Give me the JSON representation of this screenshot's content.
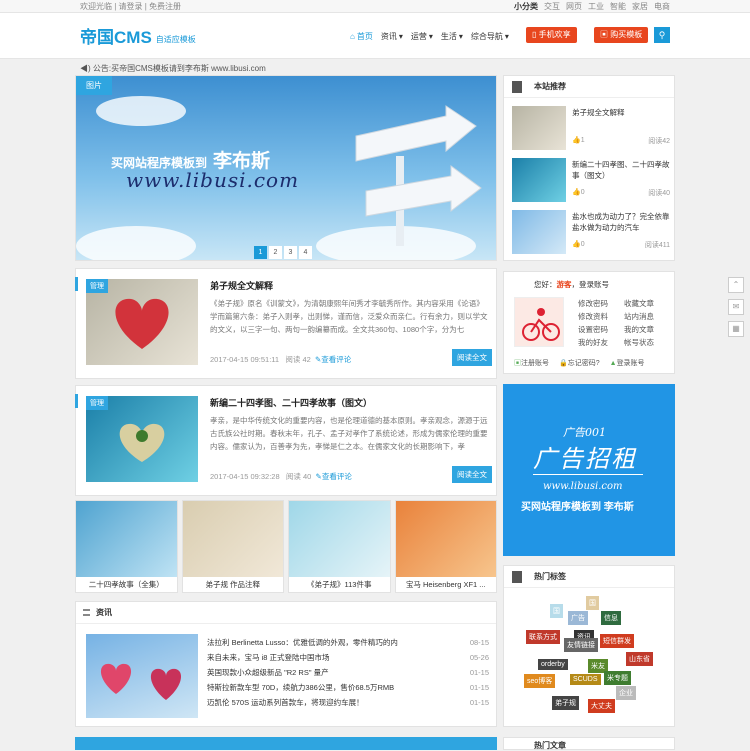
{
  "topbar": {
    "welcome": "欢迎光临",
    "login": "请登录",
    "register": "免费注册",
    "links": [
      "小分类",
      "交互",
      "网页",
      "工业",
      "智能",
      "家居",
      "电商"
    ]
  },
  "header": {
    "logo": "帝国CMS",
    "logo_sub": "自适应模板",
    "nav": [
      "首页",
      "资讯",
      "运营",
      "生活",
      "综合导航"
    ],
    "btn_mobile": "手机欢享",
    "btn_buy": "购买模板"
  },
  "notice": "公告:买帝国CMS模板请到李布斯 www.libusi.com",
  "slider": {
    "tag": "图片",
    "title": "买网站程序模板到",
    "title_big": "李布斯",
    "url": "www.libusi.com",
    "pages": [
      "1",
      "2",
      "3",
      "4"
    ]
  },
  "posts": [
    {
      "cat": "管理",
      "title": "弟子规全文解释",
      "desc": "《弟子规》原名《训蒙文》，为清朝康熙年间秀才李毓秀所作。其内容采用《论语》学而篇第六条：弟子入则孝，出则悌，谨而信，泛爱众而亲仁。行有余力，则以学文的文义，以三字一句、两句一韵编纂而成。全文共360句、1080个字，分为七",
      "date": "2017-04-15 09:51:11",
      "views": "阅读 42",
      "comment": "查看评论",
      "more": "阅读全文"
    },
    {
      "cat": "管理",
      "title": "新编二十四孝图、二十四孝故事（图文）",
      "desc": "孝亲，是中华传统文化的重要内容，也是伦理道德的基本原则。孝亲观念，源源于远古氏族公社时期。春秋末年，孔子、孟子对孝作了系统论述，形成为儒家伦理的重要内容。儒家认为，百善孝为先，孝悌是仁之本。在儒家文化的长期影响下，孝",
      "date": "2017-04-15 09:32:28",
      "views": "阅读 40",
      "comment": "查看评论",
      "more": "阅读全文"
    }
  ],
  "tiles": [
    "二十四孝故事（全集）",
    "弟子规 作品注释",
    "《弟子规》113件事",
    "宝马 Heisenberg XF1 ..."
  ],
  "latest": {
    "title": "资讯",
    "items": [
      {
        "t": "法拉利 Berlinetta Lusso：优雅低调的外观，零件精巧的内",
        "d": "08-15"
      },
      {
        "t": "来自未来，宝马 i8 正式登陆中国市场",
        "d": "05-26"
      },
      {
        "t": "英国现款小众超级新品 \"R2 RS\" 量产",
        "d": "01-15"
      },
      {
        "t": "特斯拉新款车型 70D，续航力386公里，售价68.5万RMB",
        "d": "01-15"
      },
      {
        "t": "迈凯伦 570S 运动系列首款车，将现迎约车展！",
        "d": "01-15"
      }
    ]
  },
  "recommend": {
    "title": "本站推荐",
    "items": [
      {
        "t": "弟子规全文解释",
        "likes": "1",
        "views": "阅读42"
      },
      {
        "t": "新编二十四孝图、二十四孝故事（图文）",
        "likes": "0",
        "views": "阅读40"
      },
      {
        "t": "盐水也成为动力了？完全依靠盐水做为动力的汽车",
        "likes": "0",
        "views": "阅读411"
      }
    ]
  },
  "login": {
    "hello": "您好：",
    "guest": "游客",
    "action": "，登录账号",
    "links": [
      "修改密码",
      "收藏文章",
      "修改资料",
      "站内消息",
      "设置密码",
      "我的文章",
      "我的好友",
      "帐号状态"
    ],
    "register": "注册账号",
    "forgot": "忘记密码?",
    "logout": "登录账号"
  },
  "ad": {
    "num": "广告001",
    "text": "广告招租",
    "url": "www.libusi.com",
    "slogan": "买网站程序模板到 李布斯"
  },
  "tags": {
    "title": "热门标签",
    "items": [
      {
        "t": "国",
        "c": "#b7dcea"
      },
      {
        "t": "国",
        "c": "#e1cba0"
      },
      {
        "t": "广告",
        "c": "#9bb8d6"
      },
      {
        "t": "信息",
        "c": "#2f6b3f"
      },
      {
        "t": "联系方式",
        "c": "#c0392b"
      },
      {
        "t": "资讯",
        "c": "#333"
      },
      {
        "t": "友情链接",
        "c": "#666"
      },
      {
        "t": "短信群发",
        "c": "#d03c1f"
      },
      {
        "t": "山东省",
        "c": "#c0392b"
      },
      {
        "t": "orderby",
        "c": "#444"
      },
      {
        "t": "米友",
        "c": "#5a8a2b"
      },
      {
        "t": "seo博客",
        "c": "#e08a1e"
      },
      {
        "t": "SCUDS",
        "c": "#b58a17"
      },
      {
        "t": "米专题",
        "c": "#3f7d30"
      },
      {
        "t": "企业",
        "c": "#bbbbbb"
      },
      {
        "t": "弟子规",
        "c": "#444"
      },
      {
        "t": "大丈夫",
        "c": "#d03c1f"
      }
    ]
  },
  "hot": {
    "title": "热门文章"
  },
  "colors": {
    "accent": "#2fa5e0",
    "orange": "#e8461e"
  }
}
